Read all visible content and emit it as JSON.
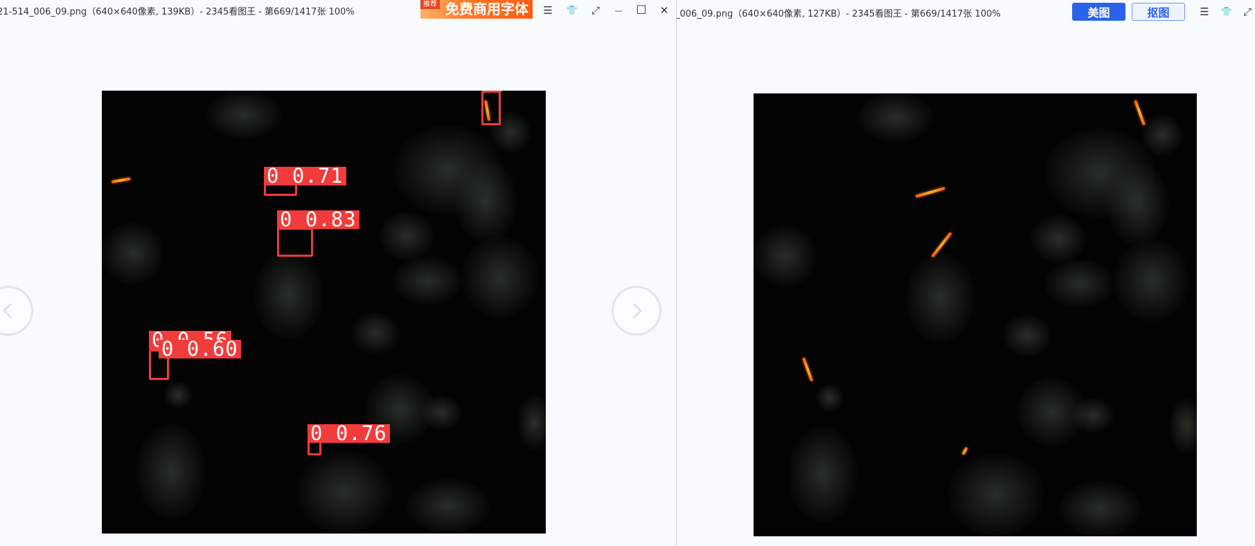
{
  "left_window": {
    "title": "21-514_006_09.png（640×640像素, 139KB）- 2345看图王 - 第669/1417张 100%",
    "ad": {
      "tag": "推荐",
      "text": "免费商用字体"
    },
    "controls": {
      "menu": "☰",
      "skin": "👕",
      "fullscreen": "⤢",
      "minimize": "—",
      "maximize": "☐",
      "close": "✕"
    },
    "detections": [
      {
        "label": "0 0.71"
      },
      {
        "label": "0 0.83"
      },
      {
        "label": "0 0.56"
      },
      {
        "label": "0 0.60"
      },
      {
        "label": "0 0.76"
      },
      {
        "label": ""
      }
    ]
  },
  "right_window": {
    "title": "_006_09.png（640×640像素, 127KB）- 2345看图王 - 第669/1417张 100%",
    "buttons": {
      "meitu": "美图",
      "koutu": "抠图"
    },
    "controls": {
      "menu": "☰",
      "skin": "👕",
      "fullscreen": "⤢"
    }
  },
  "colors": {
    "detection": "#f23b3b",
    "accent_blue": "#2b63e8",
    "background": "#f7fbfd"
  }
}
